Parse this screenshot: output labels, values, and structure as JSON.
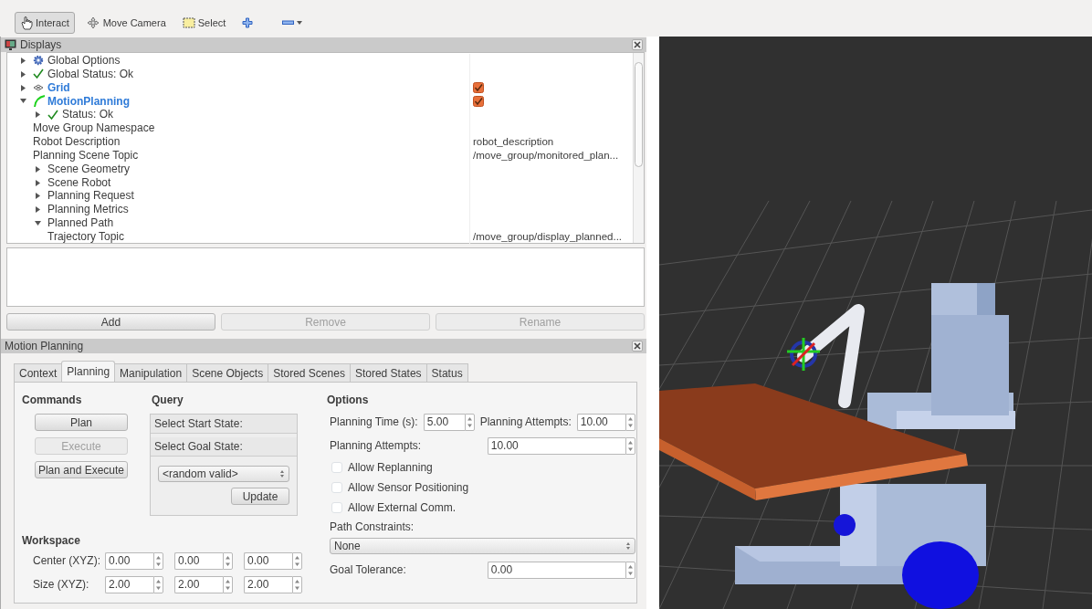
{
  "toolbar": {
    "tools": [
      {
        "label": "Interact",
        "kind": "interact",
        "selected": true
      },
      {
        "label": "Move Camera",
        "kind": "camera",
        "selected": false
      },
      {
        "label": "Select",
        "kind": "select",
        "selected": false
      }
    ],
    "actions": [
      {
        "kind": "add"
      },
      {
        "kind": "remove"
      }
    ]
  },
  "displays": {
    "title": "Displays",
    "tree": [
      {
        "label": "Global Options",
        "kind": "options",
        "expanded": false
      },
      {
        "label": "Global Status: Ok",
        "kind": "status",
        "expanded": false
      },
      {
        "label": "Grid",
        "kind": "grid",
        "expanded": false,
        "checked": true
      },
      {
        "label": "MotionPlanning",
        "kind": "planning",
        "expanded": true,
        "checked": true,
        "children": [
          {
            "label": "Status: Ok",
            "kind": "status",
            "expanded": false
          },
          {
            "label": "Move Group Namespace"
          },
          {
            "label": "Robot Description",
            "value": "robot_description"
          },
          {
            "label": "Planning Scene Topic",
            "value": "/move_group/monitored_plan..."
          },
          {
            "label": "Scene Geometry",
            "expanded": false
          },
          {
            "label": "Scene Robot",
            "expanded": false
          },
          {
            "label": "Planning Request",
            "expanded": false
          },
          {
            "label": "Planning Metrics",
            "expanded": false
          },
          {
            "label": "Planned Path",
            "expanded": true,
            "children": [
              {
                "label": "Trajectory Topic",
                "value": "/move_group/display_planned..."
              }
            ]
          }
        ]
      }
    ],
    "buttons": [
      {
        "label": "Add",
        "disabled": false
      },
      {
        "label": "Remove",
        "disabled": true
      },
      {
        "label": "Rename",
        "disabled": true
      }
    ]
  },
  "motion_planning": {
    "title": "Motion Planning",
    "tabs": [
      {
        "label": "Context",
        "selected": false
      },
      {
        "label": "Planning",
        "selected": true
      },
      {
        "label": "Manipulation",
        "selected": false
      },
      {
        "label": "Scene Objects",
        "selected": false
      },
      {
        "label": "Stored Scenes",
        "selected": false
      },
      {
        "label": "Stored States",
        "selected": false
      },
      {
        "label": "Status",
        "selected": false
      }
    ],
    "commands": {
      "heading": "Commands",
      "buttons": [
        {
          "label": "Plan",
          "disabled": false
        },
        {
          "label": "Execute",
          "disabled": true
        },
        {
          "label": "Plan and Execute",
          "disabled": false
        }
      ]
    },
    "query": {
      "heading": "Query",
      "start_label": "Select Start State:",
      "goal_label": "Select Goal State:",
      "goal_select": "<random valid>",
      "update_button": "Update"
    },
    "workspace": {
      "heading": "Workspace",
      "rows": [
        {
          "label": "Center (XYZ):",
          "values": [
            "0.00",
            "0.00",
            "0.00"
          ]
        },
        {
          "label": "Size (XYZ):",
          "values": [
            "2.00",
            "2.00",
            "2.00"
          ]
        }
      ]
    },
    "options": {
      "heading": "Options",
      "planning_time": {
        "label": "Planning Time (s):",
        "value": "5.00"
      },
      "planning_attempts_inline": {
        "label": "Planning Attempts:",
        "value": "10.00"
      },
      "planning_attempts": {
        "label": "Planning Attempts:",
        "value": "10.00"
      },
      "checkboxes": [
        {
          "label": "Allow Replanning",
          "checked": false
        },
        {
          "label": "Allow Sensor Positioning",
          "checked": false
        },
        {
          "label": "Allow External Comm.",
          "checked": false
        }
      ],
      "path_constraints": {
        "label": "Path Constraints:",
        "value": "None"
      },
      "goal_tolerance": {
        "label": "Goal Tolerance:",
        "value": "0.00"
      }
    }
  },
  "viewport": {
    "kind": "scene"
  }
}
